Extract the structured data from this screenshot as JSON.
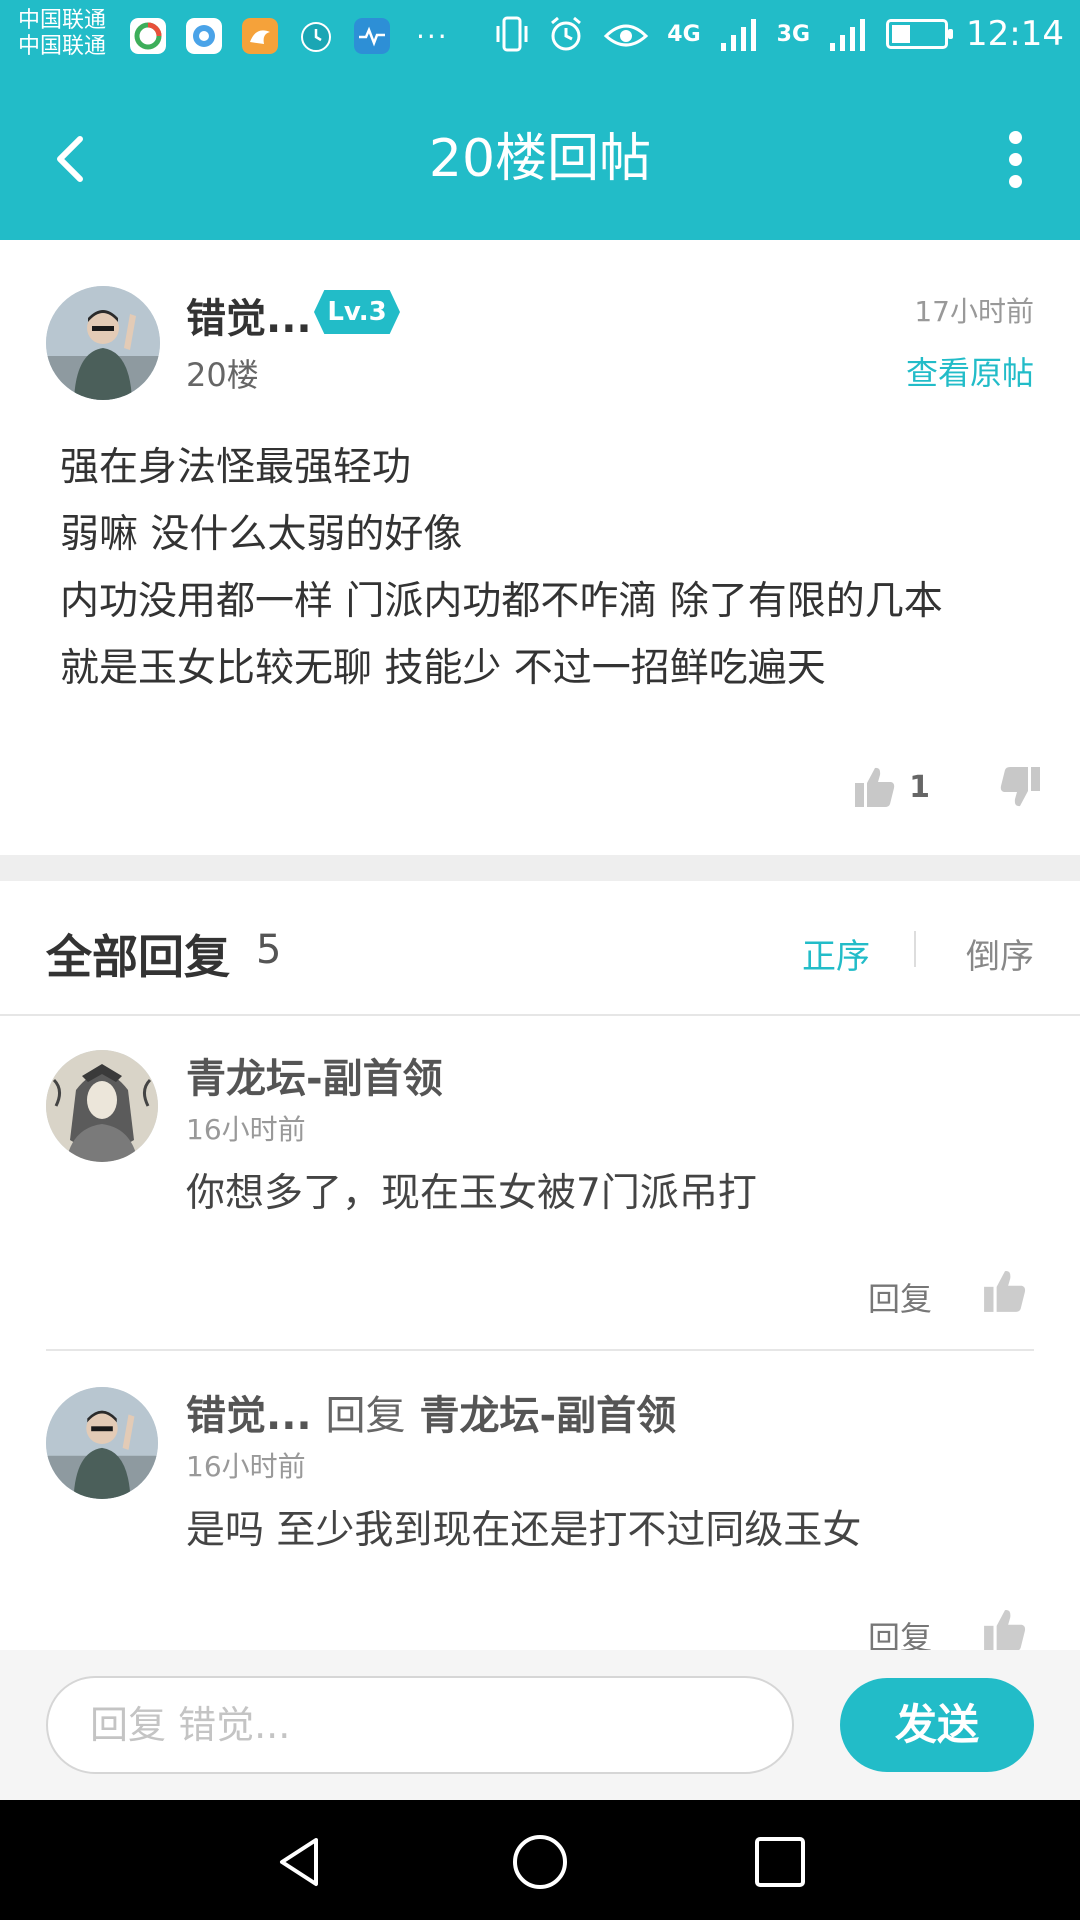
{
  "status_bar": {
    "carrier_1": "中国联通",
    "carrier_2": "中国联通",
    "network_1": "4G",
    "network_2": "3G",
    "battery_level": 0.35,
    "time": "12:14"
  },
  "header": {
    "title": "20楼回帖"
  },
  "post": {
    "author": "错觉...",
    "level": "Lv.3",
    "floor": "20楼",
    "time": "17小时前",
    "view_original": "查看原帖",
    "lines": [
      "强在身法怪最强轻功",
      "弱嘛 没什么太弱的好像",
      "内功没用都一样 门派内功都不咋滴 除了有限的几本",
      "就是玉女比较无聊 技能少 不过一招鲜吃遍天"
    ],
    "like_count": "1"
  },
  "replies_header": {
    "title": "全部回复",
    "count": "5",
    "sort_asc": "正序",
    "sort_desc": "倒序"
  },
  "replies": [
    {
      "author": "青龙坛-副首领",
      "reply_to_word": "",
      "reply_to_name": "",
      "time": "16小时前",
      "text": "你想多了，现在玉女被7门派吊打",
      "reply_label": "回复"
    },
    {
      "author": "错觉...",
      "reply_to_word": "回复",
      "reply_to_name": "青龙坛-副首领",
      "time": "16小时前",
      "text": "是吗 至少我到现在还是打不过同级玉女",
      "reply_label": "回复"
    }
  ],
  "input_bar": {
    "placeholder": "回复 错觉...",
    "send_label": "发送"
  },
  "colors": {
    "accent": "#22bcc8",
    "nav_bar": "#000000"
  }
}
